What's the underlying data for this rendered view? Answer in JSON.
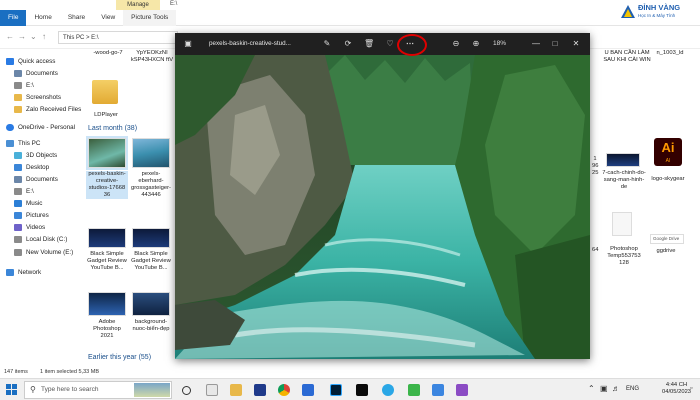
{
  "window": {
    "manage_tab": "Manage",
    "path_title": "E:\\"
  },
  "ribbon": {
    "tabs": [
      "File",
      "Home",
      "Share",
      "View",
      "Picture Tools"
    ]
  },
  "address": {
    "path": "This PC  >  E:\\"
  },
  "sidebar": {
    "items": [
      {
        "label": "Quick access",
        "icon": "star-icon",
        "color": "#2a7be4"
      },
      {
        "label": "Documents",
        "icon": "documents-icon",
        "color": "#6b86a8"
      },
      {
        "label": "E:\\",
        "icon": "drive-icon",
        "color": "#8a8a8a"
      },
      {
        "label": "Screenshots",
        "icon": "folder-icon",
        "color": "#e8b84a"
      },
      {
        "label": "Zalo Received Files",
        "icon": "folder-icon",
        "color": "#e8b84a"
      },
      {
        "label": "OneDrive - Personal",
        "icon": "cloud-icon",
        "color": "#2a7be4"
      },
      {
        "label": "This PC",
        "icon": "computer-icon",
        "color": "#4a8fd4"
      },
      {
        "label": "3D Objects",
        "icon": "cube-icon",
        "color": "#4ab0d9"
      },
      {
        "label": "Desktop",
        "icon": "desktop-icon",
        "color": "#3b86d8"
      },
      {
        "label": "Documents",
        "icon": "documents-icon",
        "color": "#6b86a8"
      },
      {
        "label": "E:\\",
        "icon": "drive-icon",
        "color": "#8a8a8a"
      },
      {
        "label": "Music",
        "icon": "music-icon",
        "color": "#2c7fd6"
      },
      {
        "label": "Pictures",
        "icon": "pictures-icon",
        "color": "#3b86d8"
      },
      {
        "label": "Videos",
        "icon": "videos-icon",
        "color": "#6e62c9"
      },
      {
        "label": "Local Disk (C:)",
        "icon": "disk-icon",
        "color": "#8a8a8a"
      },
      {
        "label": "New Volume (E:)",
        "icon": "disk-icon",
        "color": "#8a8a8a"
      },
      {
        "label": "Network",
        "icon": "network-icon",
        "color": "#3b86d8"
      }
    ]
  },
  "content": {
    "top_captions": [
      "-wood-go-7",
      "YpYEOKzNI kSP43HXCN ftV",
      "U BAN CẦN LÀM SAU KHI CÀI WIN",
      "n_1003_ld"
    ],
    "folder_label": "LDPlayer",
    "group_last_month": "Last month (38)",
    "group_earlier": "Earlier this year (55)",
    "files": [
      {
        "caption": "pexels-baskin-creative-studios-17668 36"
      },
      {
        "caption": "pexels-eberhard-grossgasteiger-443446"
      },
      {
        "caption": "Black Simple Gadget Review YouTube B..."
      },
      {
        "caption": "Black Simple Gadget Review YouTube B..."
      },
      {
        "caption": "Adobe Photoshop 2021"
      },
      {
        "caption": "background-nuoc-biển-đẹp"
      }
    ],
    "right_files": [
      {
        "caption": "7-cach-chinh-do-sang-man-hinh-de"
      },
      {
        "caption": "logo-skygear"
      },
      {
        "caption": "Photoshop Temp553753 128"
      },
      {
        "caption": "ggdrive"
      }
    ],
    "ai_text": "Ai",
    "ai_small": "AI",
    "gdrive_label": "Google Drive",
    "side_frags": [
      "1",
      "96",
      "25",
      "64"
    ]
  },
  "status": {
    "items_count": "147 items",
    "selected": "1 item selected  5,33 MB"
  },
  "viewer": {
    "title": "pexels-baskin-creative-stud...",
    "zoom": "18%"
  },
  "taskbar": {
    "search_placeholder": "Type here to search",
    "language": "ENG",
    "time": "4:44 CH",
    "date": "04/05/2023"
  },
  "logo": {
    "name": "ĐỈNH VÀNG",
    "tagline": "Học In & Máy Tính"
  }
}
